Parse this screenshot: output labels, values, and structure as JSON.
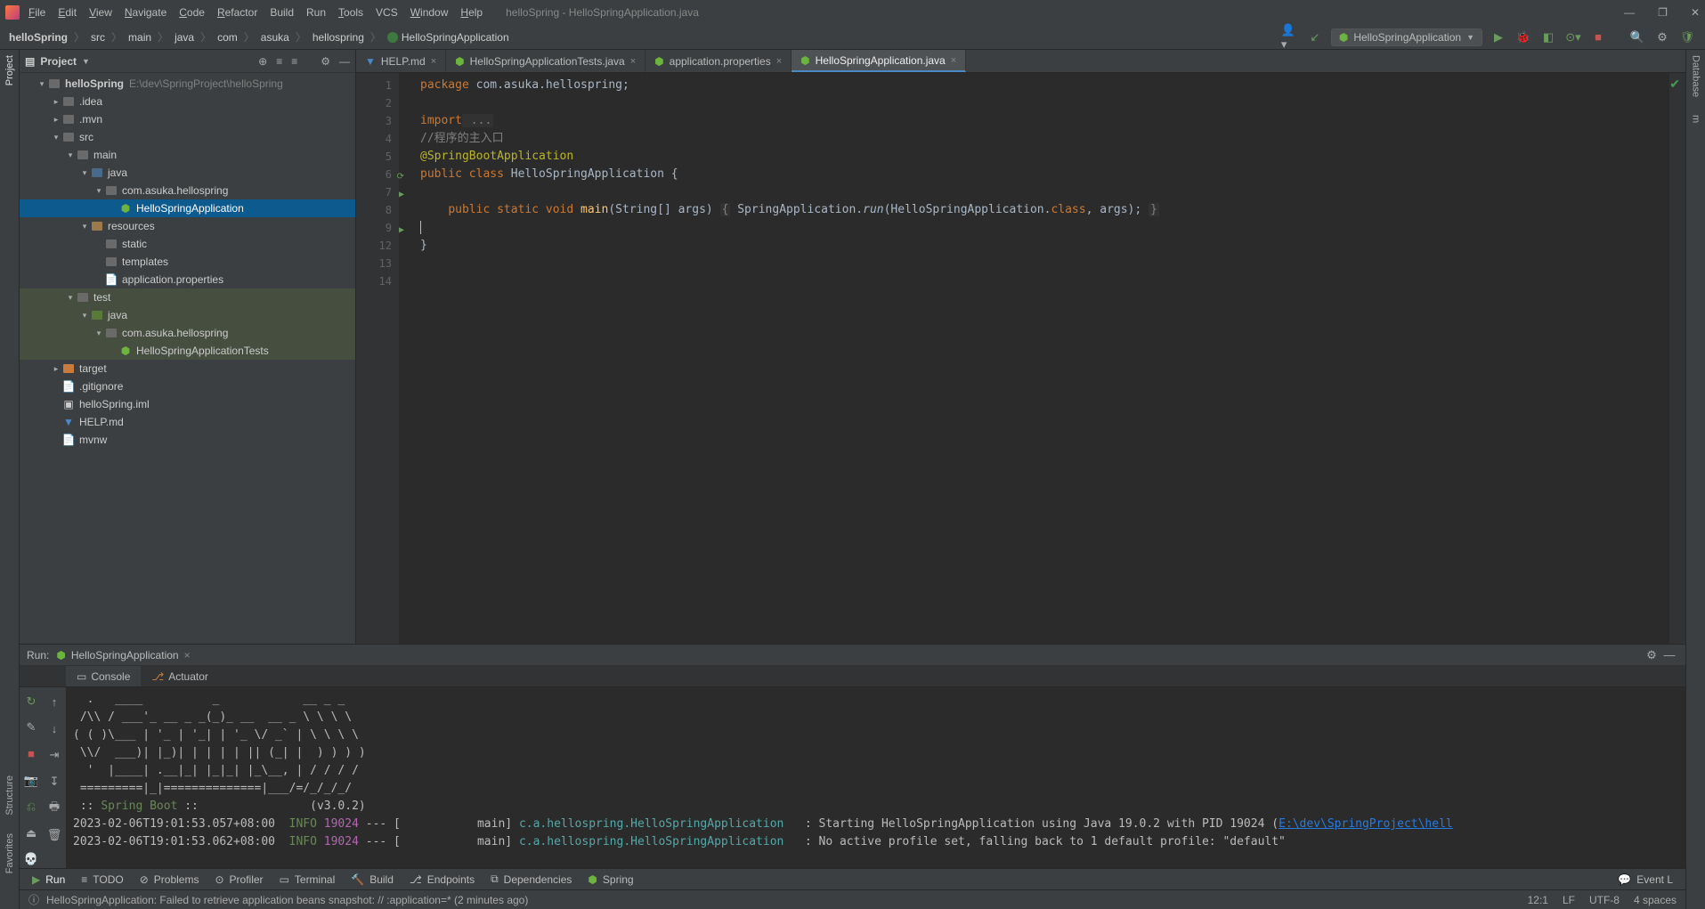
{
  "window": {
    "title": "helloSpring - HelloSpringApplication.java",
    "titlebar_buttons": {
      "min": "—",
      "max": "❐",
      "close": "✕"
    }
  },
  "menu": {
    "file": "File",
    "edit": "Edit",
    "view": "View",
    "navigate": "Navigate",
    "code": "Code",
    "refactor": "Refactor",
    "build": "Build",
    "run": "Run",
    "tools": "Tools",
    "vcs": "VCS",
    "window": "Window",
    "help": "Help"
  },
  "breadcrumbs": [
    "helloSpring",
    "src",
    "main",
    "java",
    "com",
    "asuka",
    "hellospring",
    "HelloSpringApplication"
  ],
  "toolbar": {
    "run_config": "HelloSpringApplication"
  },
  "left_tabs": {
    "project": "Project",
    "structure": "Structure",
    "favorites": "Favorites"
  },
  "right_tabs": {
    "database": "Database",
    "maven": "Maven",
    "m": "m"
  },
  "project_tool": {
    "title": "Project",
    "root": {
      "name": "helloSpring",
      "path": "E:\\dev\\SpringProject\\helloSpring"
    },
    "items": {
      "idea": ".idea",
      "mvn": ".mvn",
      "src": "src",
      "main": "main",
      "java": "java",
      "pkg": "com.asuka.hellospring",
      "app": "HelloSpringApplication",
      "resources": "resources",
      "static": "static",
      "templates": "templates",
      "appprop": "application.properties",
      "test": "test",
      "testjava": "java",
      "testpkg": "com.asuka.hellospring",
      "tests": "HelloSpringApplicationTests",
      "target": "target",
      "gitignore": ".gitignore",
      "iml": "helloSpring.iml",
      "helpmd": "HELP.md",
      "mvnw": "mvnw"
    }
  },
  "editor_tabs": [
    {
      "label": "HELP.md",
      "icon": "md",
      "active": false
    },
    {
      "label": "HelloSpringApplicationTests.java",
      "icon": "java",
      "active": false
    },
    {
      "label": "application.properties",
      "icon": "prop",
      "active": false
    },
    {
      "label": "HelloSpringApplication.java",
      "icon": "java",
      "active": true
    }
  ],
  "gutter_lines": [
    "1",
    "2",
    "3",
    "4",
    "5",
    "6",
    "7",
    "8",
    "9",
    "12",
    "13",
    "14"
  ],
  "code": {
    "l1_kw": "package",
    "l1_rest": " com.asuka.hellospring;",
    "l3_kw": "import",
    "l3_rest": " ...",
    "l4": "//程序的主入口",
    "l5": "@SpringBootApplication",
    "l6_kw": "public class ",
    "l6_cls": "HelloSpringApplication",
    "l6_rest": " {",
    "l9a": "    ",
    "l9_kw": "public static void ",
    "l9_fn": "main",
    "l9_mid": "(String[] args) ",
    "l9_open": "{",
    "l9_call": " SpringApplication.",
    "l9_run": "run",
    "l9_args": "(HelloSpringApplication.",
    "l9_class": "class",
    "l9_end": ", args); ",
    "l9_close": "}",
    "l12": "",
    "l13": "}"
  },
  "run_tool": {
    "label": "Run:",
    "config": "HelloSpringApplication",
    "tabs": {
      "console": "Console",
      "actuator": "Actuator"
    }
  },
  "console_lines": [
    {
      "t": "  .   ____          _            __ _ _"
    },
    {
      "t": " /\\\\ / ___'_ __ _ _(_)_ __  __ _ \\ \\ \\ \\"
    },
    {
      "t": "( ( )\\___ | '_ | '_| | '_ \\/ _` | \\ \\ \\ \\"
    },
    {
      "t": " \\\\/  ___)| |_)| | | | | || (_| |  ) ) ) )"
    },
    {
      "t": "  '  |____| .__|_| |_|_| |_\\__, | / / / /"
    },
    {
      "t": " =========|_|==============|___/=/_/_/_/"
    },
    {
      "prefix": " :: ",
      "grn": "Spring Boot",
      "suffix": " ::                (v3.0.2)"
    },
    {
      "t": ""
    },
    {
      "ts": "2023-02-06T19:01:53.057+08:00",
      "level": "INFO",
      "pid": "19024",
      "th": " --- [           main] ",
      "logger": "c.a.hellospring.HelloSpringApplication",
      "sep": "   : ",
      "msg": "Starting HelloSpringApplication using Java 19.0.2 with PID 19024 (",
      "link": "E:\\dev\\SpringProject\\hell"
    },
    {
      "ts": "2023-02-06T19:01:53.062+08:00",
      "level": "INFO",
      "pid": "19024",
      "th": " --- [           main] ",
      "logger": "c.a.hellospring.HelloSpringApplication",
      "sep": "   : ",
      "msg": "No active profile set, falling back to 1 default profile: \"default\""
    }
  ],
  "bottom_tabs": {
    "run": "Run",
    "todo": "TODO",
    "problems": "Problems",
    "profiler": "Profiler",
    "terminal": "Terminal",
    "build": "Build",
    "endpoints": "Endpoints",
    "dependencies": "Dependencies",
    "spring": "Spring",
    "eventlog": "Event L"
  },
  "status": {
    "message": "HelloSpringApplication: Failed to retrieve application beans snapshot: // :application=* (2 minutes ago)",
    "pos": "12:1",
    "le": "LF",
    "enc": "UTF-8",
    "spaces": "4 spaces"
  }
}
